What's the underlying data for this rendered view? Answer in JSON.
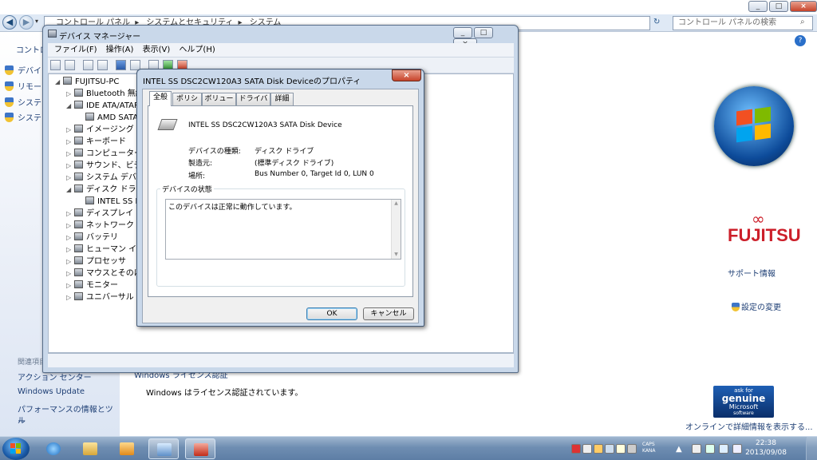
{
  "explorer": {
    "breadcrumb": [
      "コントロール パネル",
      "システムとセキュリティ",
      "システム"
    ],
    "search_placeholder": "コントロール パネルの検索",
    "left_header": "コントロ",
    "left_tasks": [
      "デバイ",
      "リモー",
      "システ",
      "システ"
    ],
    "see_also_header": "関連項目",
    "see_also": [
      "アクション センター",
      "Windows Update",
      "パフォーマンスの情報とツー",
      "ル"
    ],
    "activation_heading": "Windows ライセンス認証",
    "activation_status": "Windows はライセンス認証されています。",
    "support_link": "サポート情報",
    "change_settings": "設定の変更",
    "online_info": "オンラインで詳細情報を表示する...",
    "fujitsu": "FUJITSU",
    "genuine": {
      "ask": "ask for",
      "word": "genuine",
      "brand": "Microsoft",
      "sub": "software"
    }
  },
  "devmgr": {
    "title": "デバイス マネージャー",
    "menu": [
      "ファイル(F)",
      "操作(A)",
      "表示(V)",
      "ヘルプ(H)"
    ],
    "tree": [
      {
        "label": "FUJITSU-PC",
        "level": 0,
        "exp": "◢"
      },
      {
        "label": "Bluetooth 無線",
        "level": 1,
        "exp": "▷"
      },
      {
        "label": "IDE ATA/ATAPI",
        "level": 1,
        "exp": "◢"
      },
      {
        "label": "AMD SATA C",
        "level": 2,
        "exp": ""
      },
      {
        "label": "イメージング デ",
        "level": 1,
        "exp": "▷"
      },
      {
        "label": "キーボード",
        "level": 1,
        "exp": "▷"
      },
      {
        "label": "コンピューター",
        "level": 1,
        "exp": "▷"
      },
      {
        "label": "サウンド、ビデ",
        "level": 1,
        "exp": "▷"
      },
      {
        "label": "システム デバイ",
        "level": 1,
        "exp": "▷"
      },
      {
        "label": "ディスク ドライ",
        "level": 1,
        "exp": "◢"
      },
      {
        "label": "INTEL SS DS",
        "level": 2,
        "exp": ""
      },
      {
        "label": "ディスプレイ ア",
        "level": 1,
        "exp": "▷"
      },
      {
        "label": "ネットワーク ア",
        "level": 1,
        "exp": "▷"
      },
      {
        "label": "バッテリ",
        "level": 1,
        "exp": "▷"
      },
      {
        "label": "ヒューマン イン",
        "level": 1,
        "exp": "▷"
      },
      {
        "label": "プロセッサ",
        "level": 1,
        "exp": "▷"
      },
      {
        "label": "マウスとそのほ",
        "level": 1,
        "exp": "▷"
      },
      {
        "label": "モニター",
        "level": 1,
        "exp": "▷"
      },
      {
        "label": "ユニバーサル シ",
        "level": 1,
        "exp": "▷"
      }
    ]
  },
  "props": {
    "title": "INTEL SS DSC2CW120A3 SATA Disk Deviceのプロパティ",
    "tabs": [
      "全般",
      "ポリシー",
      "ボリューム",
      "ドライバー",
      "詳細"
    ],
    "device_name": "INTEL SS DSC2CW120A3 SATA Disk Device",
    "labels": {
      "type": "デバイスの種類:",
      "maker": "製造元:",
      "location": "場所:"
    },
    "values": {
      "type": "ディスク ドライブ",
      "maker": "(標準ディスク ドライブ)",
      "location": "Bus Number 0, Target Id 0, LUN 0"
    },
    "status_legend": "デバイスの状態",
    "status_text": "このデバイスは正常に動作しています。",
    "ok": "OK",
    "cancel": "キャンセル"
  },
  "taskbar": {
    "time": "22:38",
    "date": "2013/09/08",
    "tray_caps": "CAPS",
    "tray_kana": "KANA"
  }
}
